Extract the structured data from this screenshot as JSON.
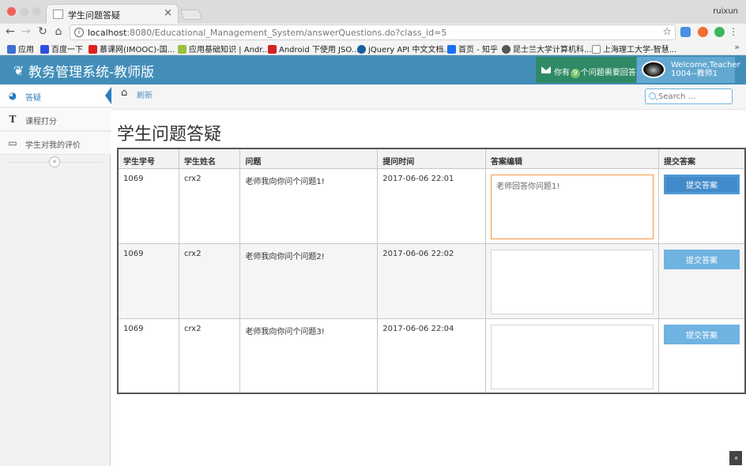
{
  "browser": {
    "tab_title": "学生问题答疑",
    "tab_close": "×",
    "profile": "ruixun",
    "url_host": "localhost",
    "url_rest": ":8080/Educational_Management_System/answerQuestions.do?class_id=5",
    "bookmarks": [
      "应用",
      "百度一下",
      "慕课网(IMOOC)-国...",
      "应用基础知识 | Andr...",
      "Android 下使用 JSO...",
      "jQuery API 中文文档...",
      "首页 - 知乎",
      "昆士兰大学计算机科...",
      "上海理工大学-智慧..."
    ]
  },
  "header": {
    "brand": "教务管理系统-教师版",
    "notify_prefix": "你有",
    "notify_count": "9",
    "notify_suffix": "个问题需要回答",
    "welcome": "Welcome,Teacher",
    "user_id": "1004--教师1"
  },
  "sidebar": {
    "items": [
      {
        "label": "答疑",
        "icon": "dashboard-icon"
      },
      {
        "label": "课程打分",
        "icon": "text-icon"
      },
      {
        "label": "学生对我的评价",
        "icon": "desktop-icon"
      }
    ],
    "collapse": "«"
  },
  "breadcrumb": {
    "refresh": "刷新"
  },
  "search": {
    "placeholder": "Search ..."
  },
  "main": {
    "title": "学生问题答疑",
    "columns": [
      "学生学号",
      "学生姓名",
      "问题",
      "提问时间",
      "答案编辑",
      "提交答案"
    ],
    "rows": [
      {
        "student_id": "1069",
        "student_name": "crx2",
        "question": "老师我向你问个问题1!",
        "time": "2017-06-06 22:01",
        "answer": "老师回答你问题1!",
        "submit": "提交答案"
      },
      {
        "student_id": "1069",
        "student_name": "crx2",
        "question": "老师我向你问个问题2!",
        "time": "2017-06-06 22:02",
        "answer": "",
        "submit": "提交答案"
      },
      {
        "student_id": "1069",
        "student_name": "crx2",
        "question": "老师我向你问个问题3!",
        "time": "2017-06-06 22:04",
        "answer": "",
        "submit": "提交答案"
      }
    ]
  },
  "scroll_top": "«"
}
